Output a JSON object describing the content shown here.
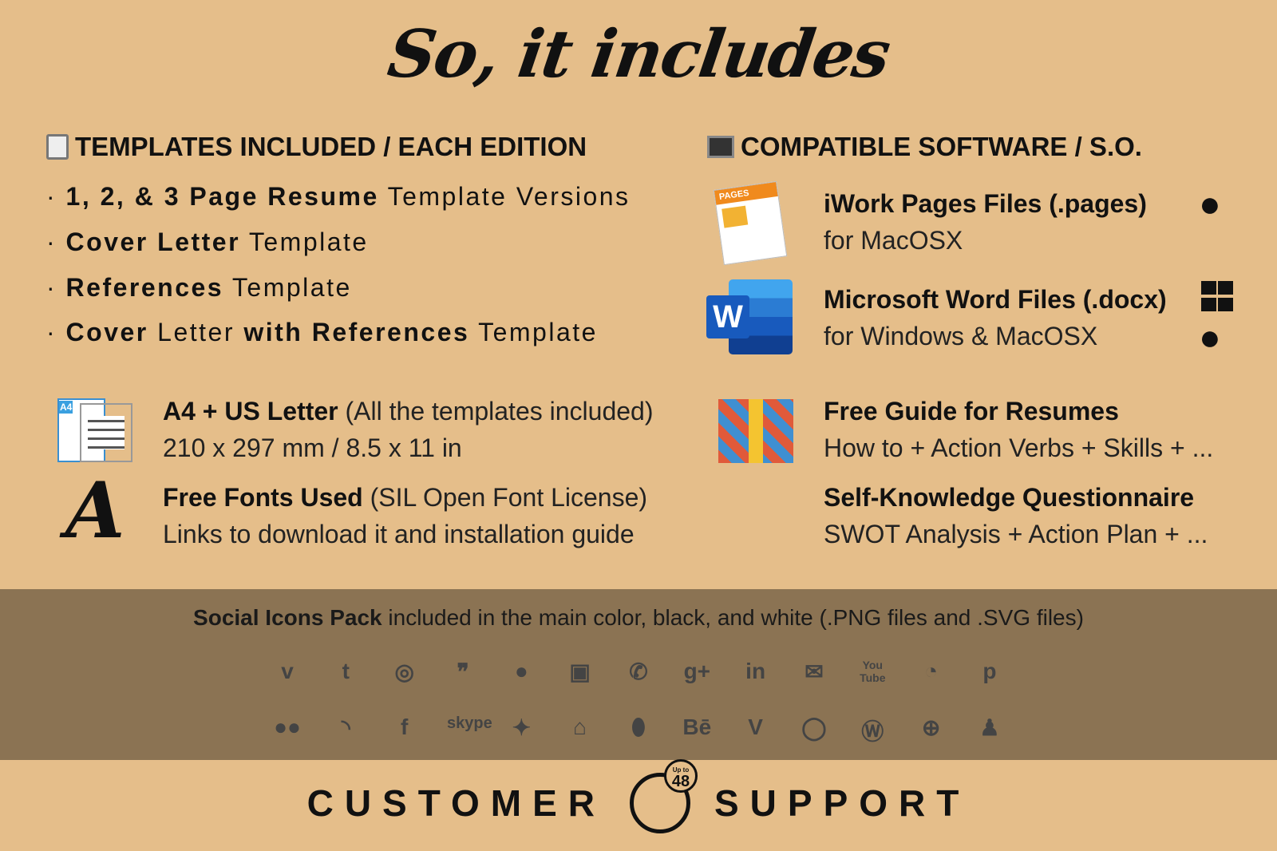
{
  "title": "So, it includes",
  "left": {
    "heading": "TEMPLATES INCLUDED /  EACH EDITION",
    "heading_icon": "clipboard-icon",
    "bullets": [
      {
        "bold": "1, 2, & 3 Page Resume",
        "rest": " Template Versions"
      },
      {
        "bold": "Cover Letter",
        "rest": " Template"
      },
      {
        "bold": "References",
        "rest": " Template"
      },
      {
        "bold": "Cover",
        "rest": " Letter ",
        "bold2": "with References",
        "rest2": " Template"
      }
    ],
    "features": [
      {
        "icon": "document-icon",
        "bold": "A4 + US Letter",
        "rest": " (All the templates included)",
        "line2": "210 x 297 mm / 8.5 x 11 in",
        "badge": "A4"
      },
      {
        "icon": "font-icon",
        "glyph": "A",
        "bold": "Free Fonts Used",
        "rest": " (SIL Open Font License)",
        "line2": "Links to download it and installation guide"
      }
    ]
  },
  "right": {
    "heading": "COMPATIBLE SOFTWARE / S.O.",
    "heading_icon": "monitor-icon",
    "items": [
      {
        "icon": "pages-icon",
        "badge": "PAGES",
        "title": "iWork Pages Files (.pages)",
        "sub": "for MacOSX",
        "os": [
          "apple-icon"
        ]
      },
      {
        "icon": "word-icon",
        "badge": "W",
        "title": "Microsoft Word Files (.docx)",
        "sub": "for Windows & MacOSX",
        "os": [
          "windows-icon",
          "apple-icon"
        ]
      },
      {
        "icon": "gift-icon",
        "title": "Free Guide for Resumes",
        "sub": "How to + Action Verbs + Skills + ..."
      },
      {
        "title": "Self-Knowledge Questionnaire",
        "sub": "SWOT Analysis + Action Plan + ..."
      }
    ]
  },
  "social": {
    "bold": "Social Icons Pack",
    "rest": " included in the main color, black, and white (.PNG files and .SVG files)",
    "row1": [
      "vimeo",
      "tumblr",
      "podcast",
      "quote",
      "chat",
      "instagram",
      "phone",
      "google-plus",
      "linkedin",
      "email",
      "youtube",
      "picasa",
      "pinterest"
    ],
    "row2": [
      "flickr",
      "rss",
      "facebook",
      "skype",
      "twitter",
      "home",
      "location",
      "behance",
      "vine",
      "whatsapp",
      "wordpress",
      "web",
      "user"
    ]
  },
  "support": {
    "left": "CUSTOMER",
    "right": "SUPPORT",
    "clock_top": "Up to",
    "clock_num": "48"
  },
  "colors": {
    "background": "#E5BE8A",
    "band": "#8B7353",
    "icons": "#444444"
  }
}
